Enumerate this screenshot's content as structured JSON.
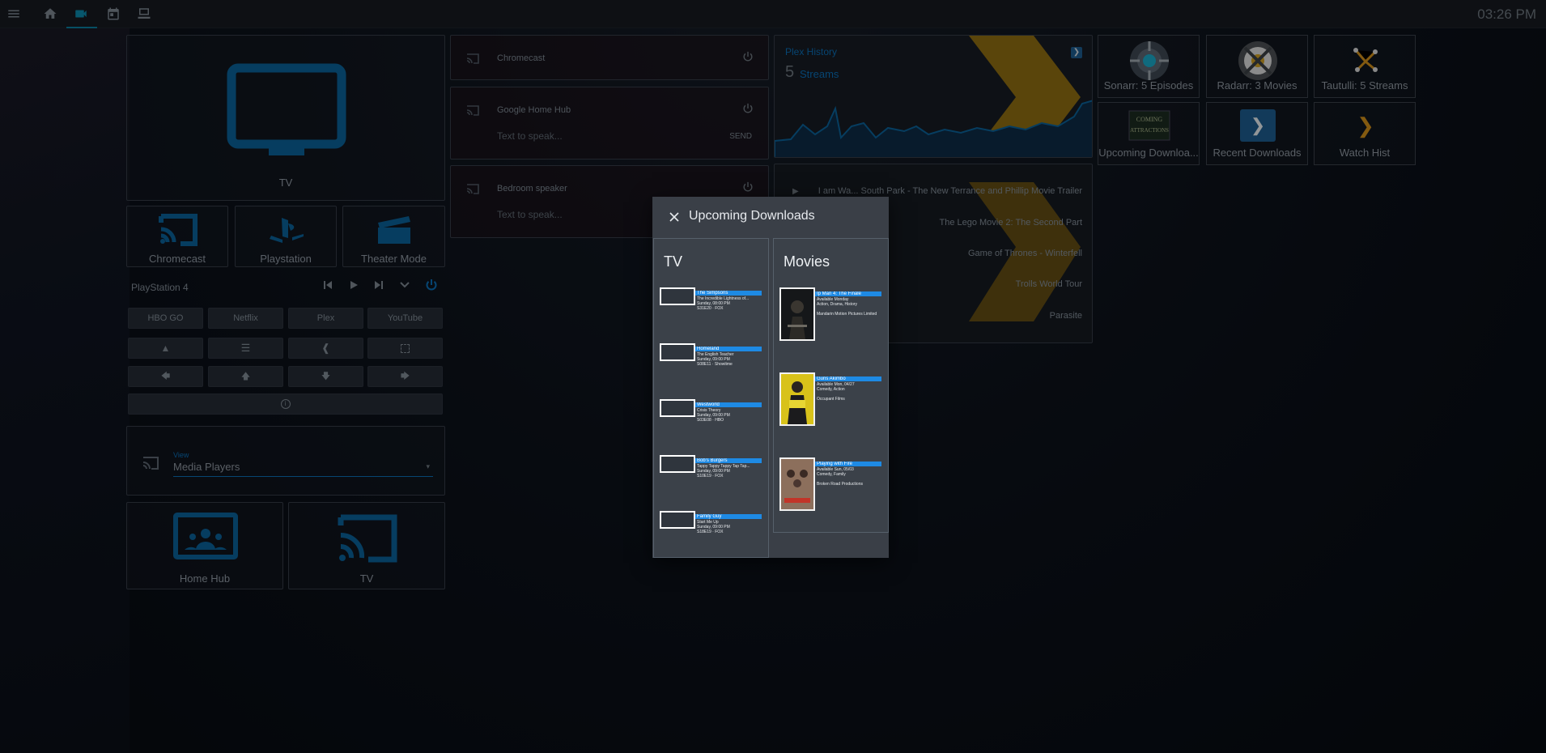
{
  "clock": "03:26 PM",
  "top_nav": [
    "menu-icon",
    "home-icon",
    "video-camera-icon",
    "calendar-icon",
    "monitor-icon"
  ],
  "left": {
    "tv_label": "TV",
    "activities": [
      "Chromecast",
      "Playstation",
      "Theater Mode"
    ],
    "player": {
      "title": "PlayStation 4",
      "apps": [
        "HBO GO",
        "Netflix",
        "Plex",
        "YouTube"
      ]
    },
    "view": {
      "label": "View",
      "value": "Media Players"
    },
    "devices": [
      "Home Hub",
      "TV"
    ]
  },
  "speakers": [
    {
      "name": "Chromecast"
    },
    {
      "name": "Google Home Hub",
      "placeholder": "Text to speak...",
      "send": "SEND"
    },
    {
      "name": "Bedroom speaker",
      "placeholder": "Text to speak..."
    }
  ],
  "plex": {
    "title": "Plex History",
    "count": "5",
    "unit": "Streams",
    "items": [
      "I am Wa... South Park - The New Terrance and Phillip Movie Trailer",
      "The Lego Movie 2: The Second Part",
      "Game of Thrones - Winterfell",
      "Trolls World Tour",
      "Parasite"
    ]
  },
  "tiles": [
    "Sonarr: 5 Episodes",
    "Radarr: 3 Movies",
    "Tautulli: 5 Streams",
    "Upcoming Downloa...",
    "Recent Downloads",
    "Watch Hist"
  ],
  "dialog": {
    "title": "Upcoming Downloads",
    "tv_header": "TV",
    "movies_header": "Movies",
    "tv": [
      {
        "show": "The Simpsons",
        "ep": "The Incredible Lightness of...",
        "l1": "Sunday, 08:00 PM",
        "l2": "S31E20 · FOX"
      },
      {
        "show": "Homeland",
        "ep": "The English Teacher",
        "l1": "Sunday, 09:00 PM",
        "l2": "S08E11 · Showtime"
      },
      {
        "show": "Westworld",
        "ep": "Crisis Theory",
        "l1": "Sunday, 09:00 PM",
        "l2": "S03E08 · HBO"
      },
      {
        "show": "Bob's Burgers",
        "ep": "Tappy Tappy Tappy Tap Tap...",
        "l1": "Sunday, 09:00 PM",
        "l2": "S10E19 · FOX"
      },
      {
        "show": "Family Guy",
        "ep": "Start Me Up",
        "l1": "Sunday, 09:00 PM",
        "l2": "S18E19 · FOX"
      }
    ],
    "movies": [
      {
        "title": "Ip Man 4: The Finale",
        "l1": "Available Monday",
        "l2": "Action, Drama, History",
        "l3": "Mandarin Motion Pictures Limited",
        "color": "#1a1c20"
      },
      {
        "title": "Guns Akimbo",
        "l1": "Available Mon, 04/27",
        "l2": "Comedy, Action",
        "l3": "Occupant Films",
        "color": "#d8c21a"
      },
      {
        "title": "Playing with Fire",
        "l1": "Available Sun, 05/03",
        "l2": "Comedy, Family",
        "l3": "Broken Road Productions",
        "color": "#6b5448"
      }
    ]
  }
}
